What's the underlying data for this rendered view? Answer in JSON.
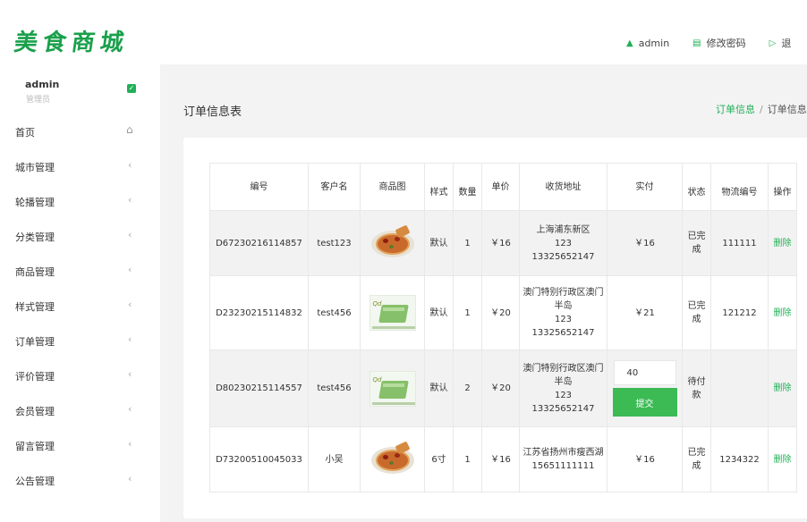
{
  "header": {
    "logo": "美食商城",
    "user_label": "admin",
    "change_password": "修改密码",
    "logout": "退",
    "icons": {
      "user": "user-icon",
      "password": "edit-icon",
      "logout": "logout-icon"
    }
  },
  "sidebar": {
    "user": {
      "name": "admin",
      "role": "管理员"
    },
    "items": [
      {
        "label": "首页",
        "icon": "home-icon"
      },
      {
        "label": "城市管理"
      },
      {
        "label": "轮播管理"
      },
      {
        "label": "分类管理"
      },
      {
        "label": "商品管理"
      },
      {
        "label": "样式管理"
      },
      {
        "label": "订单管理"
      },
      {
        "label": "评价管理"
      },
      {
        "label": "会员管理"
      },
      {
        "label": "留言管理"
      },
      {
        "label": "公告管理"
      }
    ],
    "chevron": "‹"
  },
  "page": {
    "title": "订单信息表",
    "breadcrumb": {
      "link": "订单信息",
      "sep": "/",
      "current": "订单信息表"
    }
  },
  "table": {
    "columns": [
      "编号",
      "客户名",
      "商品图",
      "样式",
      "数量",
      "单价",
      "收货地址",
      "实付",
      "状态",
      "物流编号",
      "操作"
    ],
    "delete_label": "删除",
    "submit_label": "提交",
    "rows": [
      {
        "id": "D67230216114857",
        "customer": "test123",
        "image": "pizza",
        "style": "默认",
        "qty": "1",
        "price": "￥16",
        "address": "上海浦东新区\n123\n13325652147",
        "paid": "￥16",
        "status": "已完成",
        "logistics": "111111"
      },
      {
        "id": "D23230215114832",
        "customer": "test456",
        "image": "cake",
        "style": "默认",
        "qty": "1",
        "price": "￥20",
        "address": "澳门特别行政区澳门半岛\n123\n13325652147",
        "paid": "￥21",
        "status": "已完成",
        "logistics": "121212"
      },
      {
        "id": "D80230215114557",
        "customer": "test456",
        "image": "cake",
        "style": "默认",
        "qty": "2",
        "price": "￥20",
        "address": "澳门特别行政区澳门半岛\n123\n13325652147",
        "paid_input": "40",
        "status": "待付款",
        "logistics": ""
      },
      {
        "id": "D73200510045033",
        "customer": "小吴",
        "image": "pizza",
        "style": "6寸",
        "qty": "1",
        "price": "￥16",
        "address": "江苏省扬州市瘦西湖\n15651111111",
        "paid": "￥16",
        "status": "已完成",
        "logistics": "1234322"
      }
    ]
  }
}
